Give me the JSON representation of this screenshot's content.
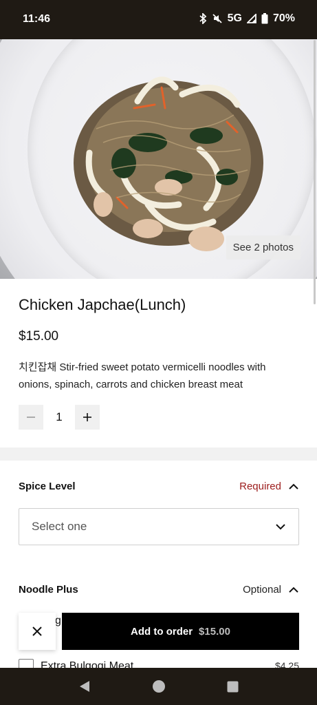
{
  "status_bar": {
    "time": "11:46",
    "network": "5G",
    "battery": "70%",
    "icons": [
      "bluetooth-icon",
      "mute-icon",
      "signal-icon",
      "battery-icon"
    ]
  },
  "hero": {
    "see_photos_label": "See 2 photos"
  },
  "item": {
    "title": "Chicken Japchae(Lunch)",
    "price": "$15.00",
    "description": "치킨잡채 Stir-fried sweet potato vermicelli noodles with onions, spinach, carrots and chicken breast meat",
    "quantity": "1"
  },
  "spice_level": {
    "label": "Spice Level",
    "status": "Required",
    "select_placeholder": "Select one"
  },
  "noodle_plus": {
    "label": "Noodle Plus",
    "status": "Optional",
    "partial_option_text": "g",
    "options": [
      {
        "label": "Extra Bulgogi Meat",
        "price": "$4.25"
      }
    ]
  },
  "footer": {
    "add_label": "Add to order",
    "add_amount": "$15.00"
  },
  "colors": {
    "required": "#9c1c1c",
    "primary_button": "#000000",
    "system_bar": "#1f1a14"
  }
}
